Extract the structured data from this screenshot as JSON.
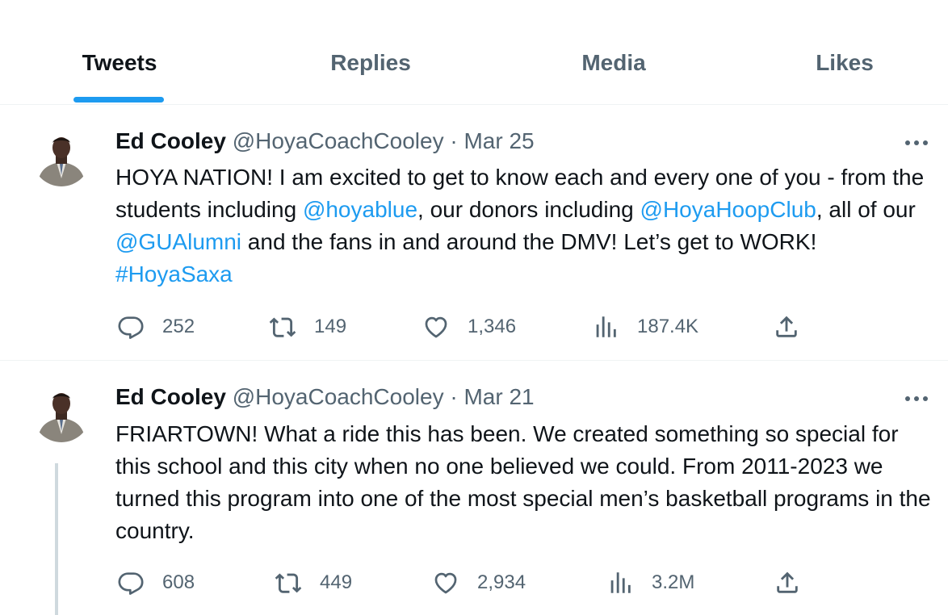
{
  "tabs": {
    "tweets": "Tweets",
    "replies": "Replies",
    "media": "Media",
    "likes": "Likes"
  },
  "tweets": [
    {
      "name": "Ed Cooley",
      "handle": "@HoyaCoachCooley",
      "separator": " · ",
      "date": "Mar 25",
      "text": {
        "t1": "HOYA NATION! I am excited to get to know each and every one of you - from the students including ",
        "m1": "@hoyablue",
        "t2": ", our donors including ",
        "m2": "@HoyaHoopClub",
        "t3": ", all of our ",
        "m3": "@GUAlumni",
        "t4": " and the fans in and around the DMV! Let’s get to WORK! ",
        "h1": "#HoyaSaxa"
      },
      "replies": "252",
      "retweets": "149",
      "likes": "1,346",
      "views": "187.4K"
    },
    {
      "name": "Ed Cooley",
      "handle": "@HoyaCoachCooley",
      "separator": " · ",
      "date": "Mar 21",
      "text": "FRIARTOWN! What a ride this has been. We created something so special for this school and this city when no one believed we could. From 2011-2023 we turned this program into one of the most special men’s basketball programs in the country.",
      "replies": "608",
      "retweets": "449",
      "likes": "2,934",
      "views": "3.2M"
    }
  ],
  "colors": {
    "accent": "#1d9bf0",
    "muted": "#536471",
    "text": "#0f1419",
    "divider": "#eff3f4"
  },
  "icons": [
    "reply-icon",
    "retweet-icon",
    "like-icon",
    "views-icon",
    "share-icon",
    "more-icon"
  ]
}
